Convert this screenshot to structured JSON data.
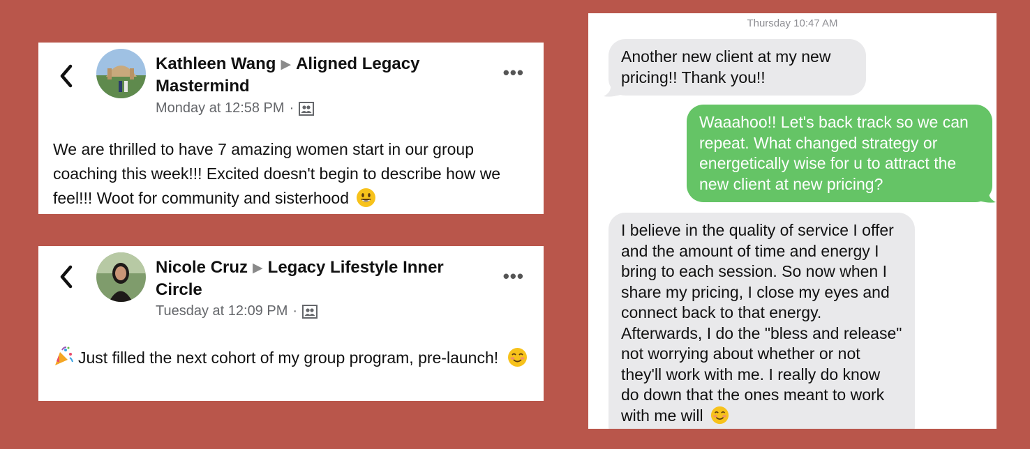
{
  "posts": [
    {
      "author": "Kathleen Wang",
      "group": "Aligned Legacy Mastermind",
      "time": "Monday at 12:58 PM",
      "separator": "·",
      "audience_icon": "group-audience-icon",
      "text": "We are thrilled to have 7 amazing women start in our group coaching this week!!! Excited doesn't begin to describe how we feel!!! Woot for community and sisterhood",
      "trailing_emoji": "smiley-emoji"
    },
    {
      "author": "Nicole Cruz",
      "group": "Legacy Lifestyle Inner Circle",
      "time": "Tuesday at 12:09 PM",
      "separator": "·",
      "audience_icon": "group-audience-icon",
      "leading_emoji": "party-popper-emoji",
      "text": "Just filled the next cohort of my group program, pre-launch!",
      "trailing_emoji": "smiling-blush-emoji"
    }
  ],
  "more_label": "•••",
  "messages": {
    "timestamp": "Thursday 10:47 AM",
    "items": [
      {
        "direction": "incoming",
        "text": "Another new client at my new pricing!! Thank you!!"
      },
      {
        "direction": "outgoing",
        "text": "Waaahoo!! Let's back track so we can repeat. What changed strategy or energetically wise for u to attract the new client at new pricing?"
      },
      {
        "direction": "incoming",
        "text": "I believe in the quality of service I offer and the amount of time and energy I bring to each session. So now when I share my pricing, I close my eyes and connect back to that energy. Afterwards, I do the \"bless and release\" not worrying about whether or not they'll work with me. I really do know do down that the ones meant to work with me will",
        "trailing_emoji": "smiling-blush-emoji"
      }
    ]
  },
  "colors": {
    "background": "#b9564b",
    "outgoing_bubble": "#65c466",
    "incoming_bubble": "#e9e9eb",
    "meta_text": "#65676b"
  }
}
